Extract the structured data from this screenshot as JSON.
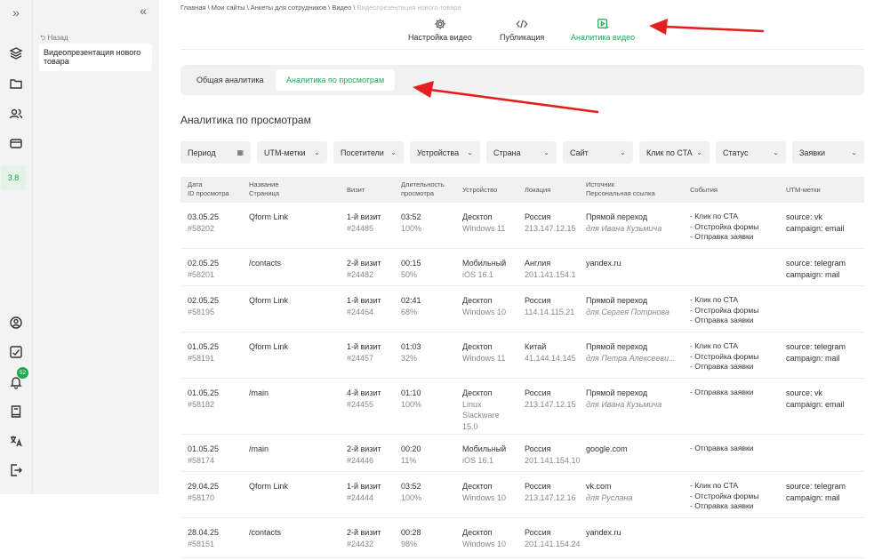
{
  "breadcrumb": {
    "path": "Главная \\ Мои сайты \\ Анкеты для сотрудников \\ Видео \\ ",
    "current": "Видеопрезентация нового товара"
  },
  "sidebar": {
    "back": "Назад",
    "project": "Видеопрезентация нового товара",
    "version": "3.8",
    "notifications": "52"
  },
  "top_tabs": [
    {
      "label": "Настройка видео",
      "icon": "gear-icon"
    },
    {
      "label": "Публикация",
      "icon": "code-icon"
    },
    {
      "label": "Аналитика видео",
      "icon": "video-analytics-icon"
    }
  ],
  "sub_tabs": [
    {
      "label": "Общая аналитика"
    },
    {
      "label": "Аналитика по просмотрам"
    }
  ],
  "section_title": "Аналитика по просмотрам",
  "filters": [
    "Период",
    "UTM-метки",
    "Посетители",
    "Устройства",
    "Страна",
    "Сайт",
    "Клик по CTA",
    "Статус",
    "Заявки"
  ],
  "columns": [
    [
      "Дата",
      "ID просмотра"
    ],
    [
      "Название",
      "Страница"
    ],
    [
      "Визит"
    ],
    [
      "Длительность",
      "просмотра"
    ],
    [
      "Устройство"
    ],
    [
      "Локация"
    ],
    [
      "Источник",
      "Персональная ссылка"
    ],
    [
      "События"
    ],
    [
      "UTM-метки"
    ]
  ],
  "rows": [
    {
      "date": "03.05.25",
      "id": "#58202",
      "page": "Qform Link",
      "visit": "1-й визит",
      "visit_id": "#24485",
      "dur": "03:52",
      "pct": "100%",
      "device": "Десктоп",
      "os": "Windows 11",
      "country": "Россия",
      "ip": "213.147.12.15",
      "source": "Прямой переход",
      "personal": "для Ивана Кузьмича",
      "events": [
        "- Клик по CTA",
        "- Отстройка формы",
        "- Отправка заявки"
      ],
      "utm": [
        "source: vk",
        "campaign: email"
      ]
    },
    {
      "date": "02.05.25",
      "id": "#58201",
      "page": "/contacts",
      "visit": "2-й визит",
      "visit_id": "#24482",
      "dur": "00:15",
      "pct": "50%",
      "device": "Мобильный",
      "os": "iOS 16.1",
      "country": "Англия",
      "ip": "201.141.154.1",
      "source": "yandex.ru",
      "personal": "",
      "events": [],
      "utm": [
        "source: telegram",
        "campaign: mail"
      ]
    },
    {
      "date": "02.05.25",
      "id": "#58195",
      "page": "Qform Link",
      "visit": "1-й визит",
      "visit_id": "#24464",
      "dur": "02:41",
      "pct": "68%",
      "device": "Десктоп",
      "os": "Windows 10",
      "country": "Россия",
      "ip": "114.14.115.21",
      "source": "Прямой переход",
      "personal": "для Сергея Потрнова",
      "events": [
        "- Клик по CTA",
        "- Отстройка формы",
        "- Отправка заявки"
      ],
      "utm": []
    },
    {
      "date": "01.05.25",
      "id": "#58191",
      "page": "Qform Link",
      "visit": "1-й визит",
      "visit_id": "#24457",
      "dur": "01:03",
      "pct": "32%",
      "device": "Десктоп",
      "os": "Windows 11",
      "country": "Китай",
      "ip": "41.144.14.145",
      "source": "Прямой переход",
      "personal": "для Петра Алексееви...",
      "events": [
        "- Клик по CTA",
        "- Отстройка формы",
        "- Отправка заявки"
      ],
      "utm": [
        "source: telegram",
        "campaign: mail"
      ]
    },
    {
      "date": "01.05.25",
      "id": "#58182",
      "page": "/main",
      "visit": "4-й визит",
      "visit_id": "#24455",
      "dur": "01:10",
      "pct": "100%",
      "device": "Десктоп",
      "os": "Linux Slackware 15.0",
      "country": "Россия",
      "ip": "213.147.12.15",
      "source": "Прямой переход",
      "personal": "для Ивана Кузьмича",
      "events": [
        "- Отправка заявки"
      ],
      "utm": [
        "source: vk",
        "campaign: email"
      ]
    },
    {
      "date": "01.05.25",
      "id": "#58174",
      "page": "/main",
      "visit": "2-й визит",
      "visit_id": "#24446",
      "dur": "00:20",
      "pct": "11%",
      "device": "Мобильный",
      "os": "iOS 16.1",
      "country": "Россия",
      "ip": "201.141.154.10",
      "source": "google.com",
      "personal": "",
      "events": [
        "- Отправка заявки"
      ],
      "utm": []
    },
    {
      "date": "29.04.25",
      "id": "#58170",
      "page": "Qform Link",
      "visit": "1-й визит",
      "visit_id": "#24444",
      "dur": "03:52",
      "pct": "100%",
      "device": "Десктоп",
      "os": "Windows 10",
      "country": "Россия",
      "ip": "213.147.12.16",
      "source": "vk.com",
      "personal": "для Руслана",
      "events": [
        "- Клик по CTA",
        "- Отстройка формы",
        "- Отправка заявки"
      ],
      "utm": [
        "source: telegram",
        "campaign: mail"
      ]
    },
    {
      "date": "28.04.25",
      "id": "#58151",
      "page": "/contacts",
      "visit": "2-й визит",
      "visit_id": "#24432",
      "dur": "00:28",
      "pct": "98%",
      "device": "Десктоп",
      "os": "Windows 10",
      "country": "Россия",
      "ip": "201.141.154.24",
      "source": "yandex.ru",
      "personal": "",
      "events": [],
      "utm": []
    }
  ],
  "colors": {
    "accent": "#23a559",
    "arrow": "#e41e1e"
  }
}
